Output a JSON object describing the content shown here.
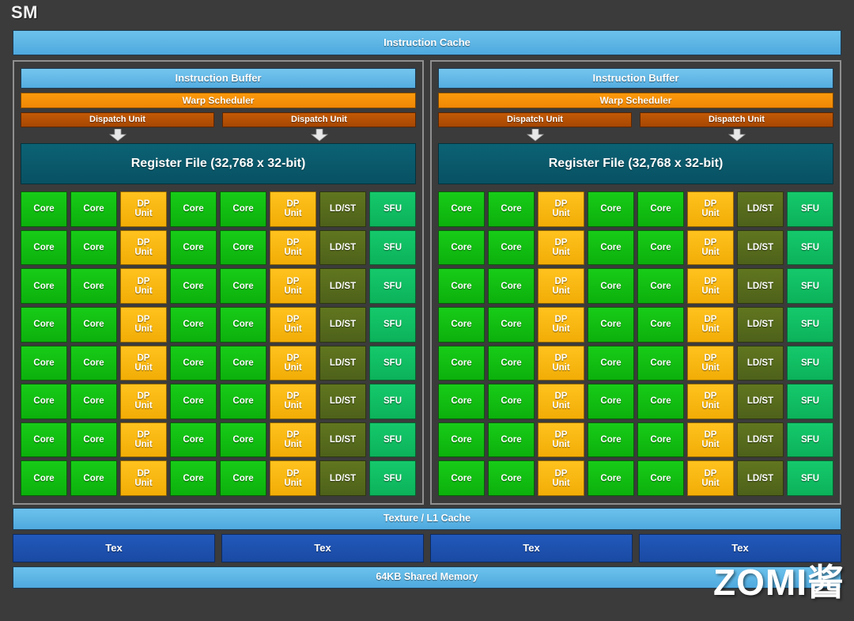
{
  "diagram": {
    "title": "SM",
    "instruction_cache": "Instruction Cache",
    "texture_l1_cache": "Texture / L1 Cache",
    "shared_memory": "64KB Shared Memory",
    "tex_label": "Tex",
    "tex_count": 4,
    "watermark": "ZOMI酱"
  },
  "partition": {
    "instruction_buffer": "Instruction Buffer",
    "warp_scheduler": "Warp Scheduler",
    "dispatch_unit": "Dispatch Unit",
    "dispatch_unit_2": "Dispatch Unit",
    "register_file": "Register File (32,768 x 32-bit)",
    "arrow_icon": "arrow-down-icon",
    "rows": 8,
    "columns": 8,
    "row_pattern": [
      "Core",
      "Core",
      "DP Unit",
      "Core",
      "Core",
      "DP Unit",
      "LD/ST",
      "SFU"
    ],
    "labels": {
      "core": "Core",
      "dp_line1": "DP",
      "dp_line2": "Unit",
      "ldst": "LD/ST",
      "sfu": "SFU"
    }
  },
  "partitions": [
    {
      "name": "left-partition"
    },
    {
      "name": "right-partition"
    }
  ],
  "colors": {
    "background": "#3b3b3b",
    "cache_blue": "#5bb8e8",
    "warp_orange": "#f8920a",
    "dispatch_orange": "#b95205",
    "register_teal": "#0a5c6e",
    "core_green": "#12be12",
    "dp_amber": "#f7b712",
    "ldst_olive": "#58701d",
    "sfu_green": "#11c063",
    "tex_blue": "#1e52b0",
    "partition_border": "#8f8f8f",
    "title_text": "#f2f2f2"
  }
}
